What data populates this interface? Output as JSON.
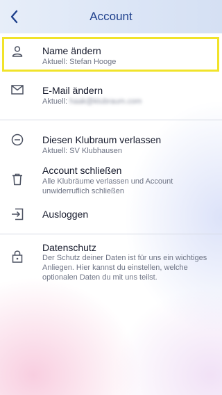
{
  "header": {
    "title": "Account",
    "back_icon": "chevron-left-icon"
  },
  "items": [
    {
      "icon": "person-icon",
      "label": "Name ändern",
      "detail": "Aktuell: Stefan Hooge"
    },
    {
      "icon": "mail-icon",
      "label": "E-Mail ändern",
      "detail_prefix": "Aktuell:",
      "detail_hidden": "haak@klubraum.com"
    },
    {
      "icon": "minus-circle-icon",
      "label": "Diesen Klubraum verlassen",
      "detail": "Aktuell: SV Klubhausen"
    },
    {
      "icon": "trash-icon",
      "label": "Account schließen",
      "detail": "Alle Klubräume verlassen und Account unwiderruflich schließen"
    },
    {
      "icon": "logout-icon",
      "label": "Ausloggen"
    },
    {
      "icon": "lock-icon",
      "label": "Datenschutz",
      "detail": "Der Schutz deiner Daten ist für uns ein wichtiges Anliegen. Hier kannst du einstellen, welche optionalen Daten du mit uns teilst."
    }
  ],
  "colors": {
    "header_text": "#1d3f8c",
    "highlight": "#f1e32a"
  }
}
